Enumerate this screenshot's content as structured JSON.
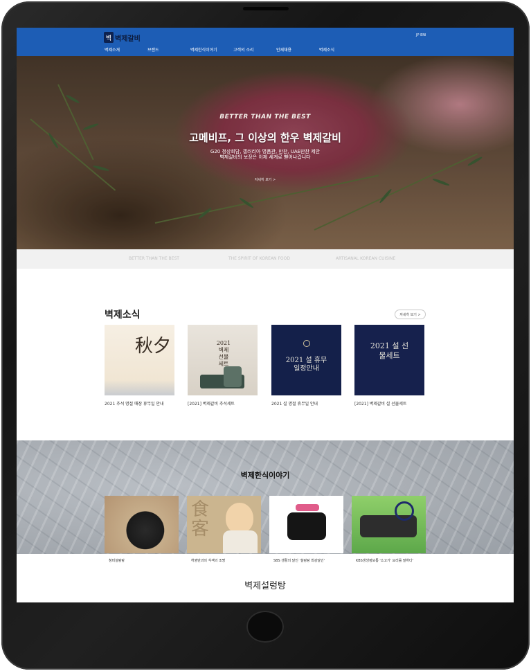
{
  "header": {
    "brand_mark": "벽",
    "brand_name": "벽제갈비",
    "lang_link": "JP ENI",
    "nav": [
      "벽제소개",
      "브랜드",
      "벽제한식이야기",
      "고객의 소리",
      "인재채용",
      "벽제소식"
    ]
  },
  "hero": {
    "tagline": "BETTER THAN THE BEST",
    "title": "고메비프, 그 이상의 한우 벽제갈비",
    "subtitle_lines": [
      "G20 정상회담, 갤러리아 명품관, 만찬, UAE만찬 제안",
      "벽제갈비의 보장은 이제 세계로 뻗어나갑니다"
    ],
    "more_link": "자세히 보기 >"
  },
  "slogans": [
    "BETTER THAN THE BEST",
    "THE SPIRIT OF KOREAN FOOD",
    "ARTISANAL KOREAN CUISINE"
  ],
  "news": {
    "title": "벽제소식",
    "more_button": "자세히 보기 >",
    "items": [
      {
        "caption": "2021 추석 명절 매장 휴무일 안내",
        "thumb_text": "秋夕"
      },
      {
        "caption": "[2021] 벽제갈비 추석세트",
        "thumb_text": "2021 벽제 선물 세트"
      },
      {
        "caption": "2021 설 명절 휴무일 안내",
        "thumb_text": "2021 설 휴무 일정안내"
      },
      {
        "caption": "[2021] 벽제갈비 설 선물세트",
        "thumb_text": "2021 설 선물세트"
      }
    ]
  },
  "story": {
    "title": "벽제한식이야기",
    "items": [
      {
        "caption": "청미설렁탕"
      },
      {
        "caption": "허영만과의 식객의 조명"
      },
      {
        "caption": "SBS 생활의 달인 '설렁탕 최강달인'"
      },
      {
        "caption": "KBS생생정보통 '소고기' 요리를 말하다'"
      }
    ]
  },
  "section_bottom": {
    "title": "벽제설렁탕"
  },
  "colors": {
    "header_bg": "#1d5db5",
    "navy_box": "#14204a"
  }
}
